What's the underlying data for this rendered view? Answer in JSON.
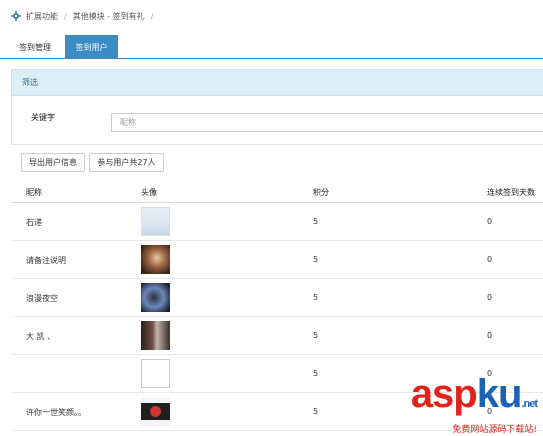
{
  "breadcrumb": {
    "items": [
      "扩展功能",
      "其他模块 - 签到有礼"
    ]
  },
  "tabs": [
    {
      "label": "签到管理"
    },
    {
      "label": "签到用户"
    }
  ],
  "filter": {
    "title": "筛选",
    "keyword_label": "关键字",
    "keyword_placeholder": "昵称",
    "keyword_value": ""
  },
  "actions": {
    "export_label": "导出用户信息",
    "participants_label": "参与用户共27人"
  },
  "table": {
    "headers": [
      "昵称",
      "头像",
      "积分",
      "连续签到天数"
    ],
    "rows": [
      {
        "nickname": "石递",
        "points": "5",
        "days": "0"
      },
      {
        "nickname": "请备注说明",
        "points": "5",
        "days": "0"
      },
      {
        "nickname": "浪漫夜空",
        "points": "5",
        "days": "0"
      },
      {
        "nickname": "大 凯 、",
        "points": "5",
        "days": "0"
      },
      {
        "nickname": "",
        "points": "5",
        "days": "0"
      },
      {
        "nickname": "许你一世笑颜。。",
        "points": "5",
        "days": "0"
      }
    ]
  },
  "watermark": {
    "brand_a": "asp",
    "brand_b": "ku",
    "suffix": ".net",
    "tagline": "免费网站源码下载站!"
  },
  "colors": {
    "accent": "#3d8bc4",
    "filter_bg": "#dceff7",
    "watermark_red": "#e0221b",
    "watermark_blue": "#1a63b4"
  },
  "icons": {
    "breadcrumb": "gear-icon"
  }
}
